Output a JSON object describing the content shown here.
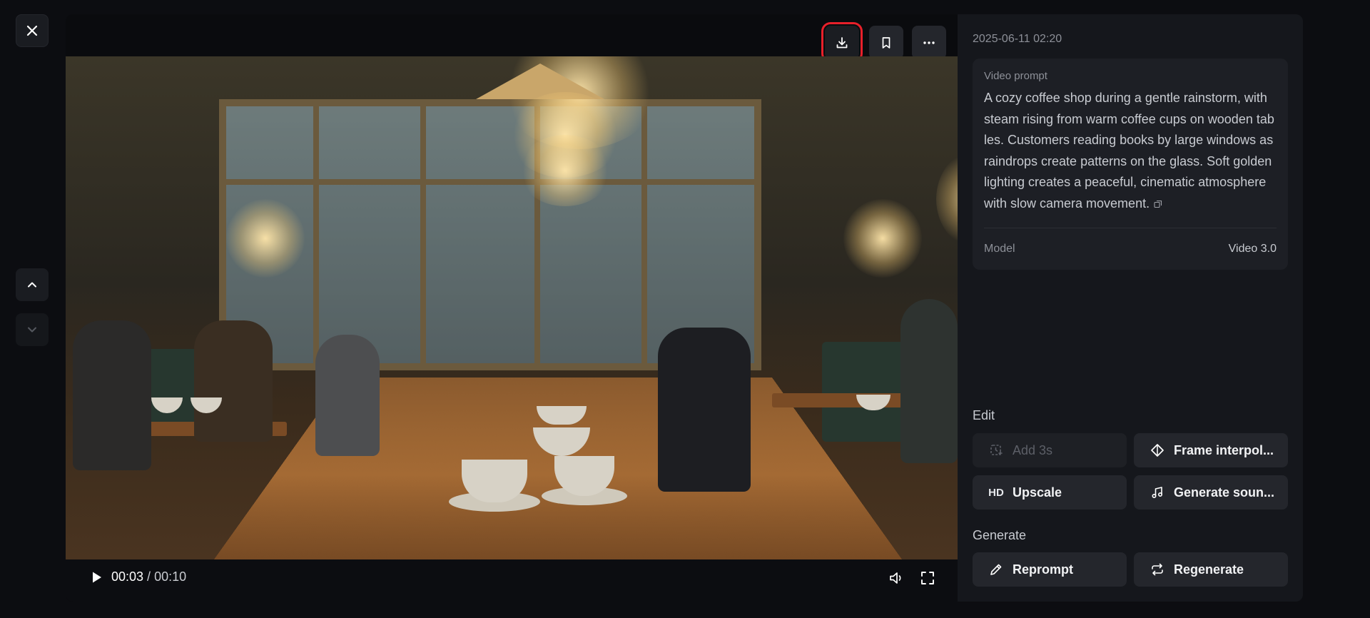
{
  "controls": {
    "close_icon": "close-icon",
    "nav_up_icon": "chevron-up-icon",
    "nav_down_icon": "chevron-down-icon"
  },
  "toolbar": {
    "download_icon": "download-icon",
    "bookmark_icon": "bookmark-icon",
    "more_icon": "more-horizontal-icon",
    "highlight_color": "#e8202a"
  },
  "player": {
    "current_time": "00:03",
    "separator": "/",
    "duration": "00:10",
    "progress": 0.25,
    "play_icon": "play-icon",
    "volume_icon": "volume-icon",
    "fullscreen_icon": "fullscreen-icon"
  },
  "details": {
    "timestamp": "2025-06-11 02:20",
    "prompt_label": "Video prompt",
    "prompt_text": "A cozy coffee shop during a gentle rainstorm, with steam rising from warm coffee cups on wooden tables. Customers reading books by large windows as raindrops create patterns on the glass. Soft golden lighting creates a peaceful, cinematic atmosphere with slow camera movement.",
    "model_label": "Model",
    "model_value": "Video 3.0"
  },
  "edit": {
    "label": "Edit",
    "add_label": "Add 3s",
    "frame_label": "Frame interpol...",
    "upscale_label": "Upscale",
    "upscale_badge": "HD",
    "sound_label": "Generate soun..."
  },
  "generate": {
    "label": "Generate",
    "reprompt_label": "Reprompt",
    "regenerate_label": "Regenerate"
  }
}
